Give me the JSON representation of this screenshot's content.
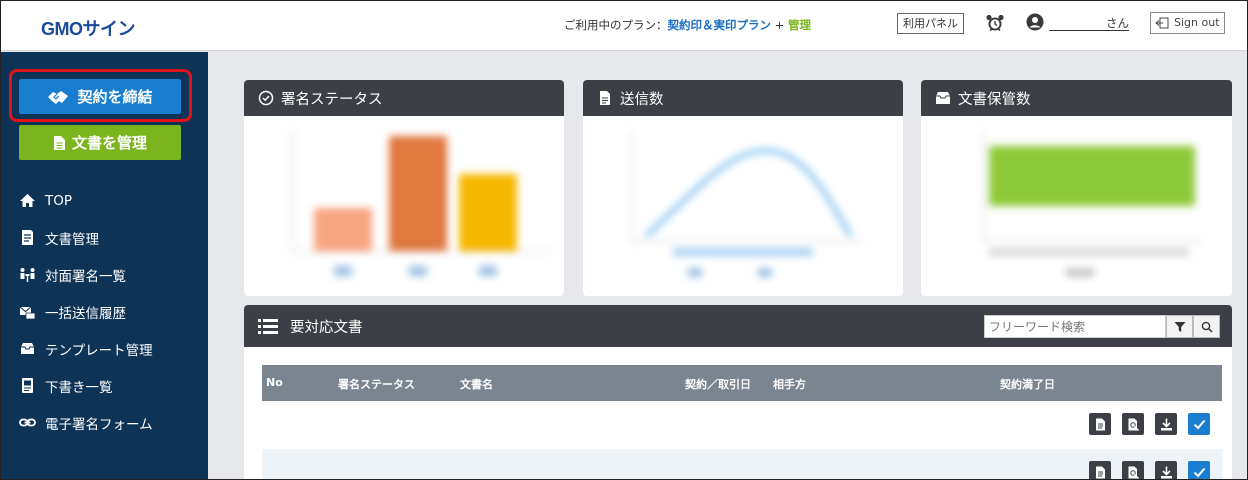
{
  "header": {
    "logo": "GMOサイン",
    "plan_prefix": "ご利用中のプラン：",
    "plan_main": "契約印＆実印プラン",
    "plan_plus": " + ",
    "plan_admin": "管理",
    "panel_button": "利用パネル",
    "user_suffix": "さん",
    "sign_out": "Sign out"
  },
  "sidebar": {
    "contract_button": "契約を締結",
    "docs_button": "文書を管理",
    "items": [
      {
        "label": "TOP",
        "icon": "home-icon"
      },
      {
        "label": "文書管理",
        "icon": "document-icon"
      },
      {
        "label": "対面署名一覧",
        "icon": "face-to-face-icon"
      },
      {
        "label": "一括送信履歴",
        "icon": "bulk-send-icon"
      },
      {
        "label": "テンプレート管理",
        "icon": "template-icon"
      },
      {
        "label": "下書き一覧",
        "icon": "draft-icon"
      },
      {
        "label": "電子署名フォーム",
        "icon": "link-icon"
      }
    ]
  },
  "cards": {
    "status_title": "署名ステータス",
    "sent_title": "送信数",
    "storage_title": "文書保管数"
  },
  "table": {
    "title": "要対応文書",
    "search_placeholder": "フリーワード検索",
    "columns": [
      "No",
      "署名ステータス",
      "文書名",
      "契約／取引日",
      "相手方",
      "契約満了日"
    ]
  },
  "colors": {
    "sidebar": "#0d3356",
    "primary": "#1a7ed0",
    "green": "#7ab51d",
    "card_header": "#3c4046",
    "highlight": "#e0131b"
  }
}
